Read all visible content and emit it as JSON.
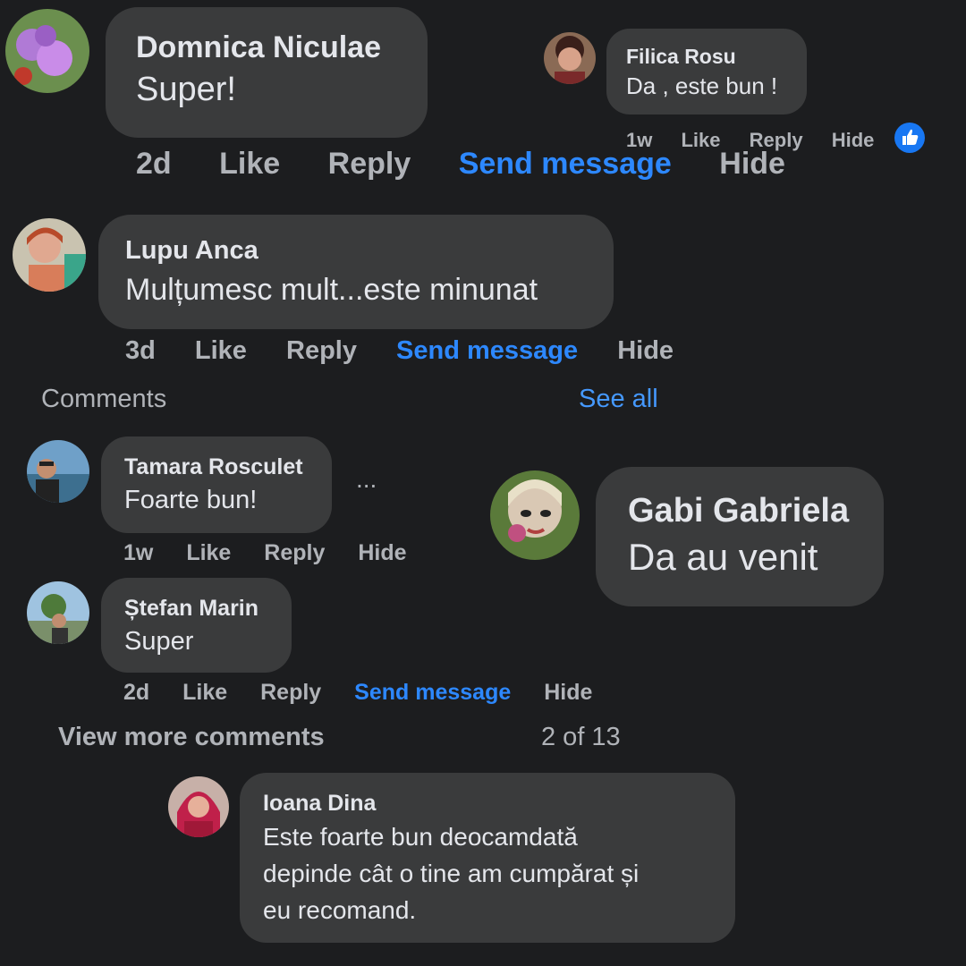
{
  "comments": {
    "domnica": {
      "name": "Domnica Niculae",
      "text": "Super!",
      "time": "2d",
      "like": "Like",
      "reply": "Reply",
      "send": "Send message",
      "hide": "Hide"
    },
    "filica": {
      "name": "Filica Rosu",
      "text": "Da , este bun !",
      "time": "1w",
      "like": "Like",
      "reply": "Reply",
      "hide": "Hide",
      "reaction_icon": "thumbs-up-icon"
    },
    "lupu": {
      "name": "Lupu Anca",
      "text": "Mulțumesc mult...este minunat",
      "time": "3d",
      "like": "Like",
      "reply": "Reply",
      "send": "Send message",
      "hide": "Hide"
    },
    "tamara": {
      "name": "Tamara Rosculet",
      "text": "Foarte bun!",
      "time": "1w",
      "like": "Like",
      "reply": "Reply",
      "hide": "Hide",
      "more": "..."
    },
    "gabi": {
      "name": "Gabi Gabriela",
      "text": "Da au venit"
    },
    "stefan": {
      "name": "Ștefan Marin",
      "text": "Super",
      "time": "2d",
      "like": "Like",
      "reply": "Reply",
      "send": "Send message",
      "hide": "Hide"
    },
    "ioana": {
      "name": "Ioana Dina",
      "lines": [
        "Este foarte bun deocamdată",
        "depinde cât o tine am cumpărat și",
        "eu recomand."
      ]
    }
  },
  "section": {
    "title": "Comments",
    "see_all": "See all"
  },
  "pagination": {
    "view_more": "View more comments",
    "count": "2 of 13"
  },
  "colors": {
    "background": "#1c1d1f",
    "bubble": "#3a3b3c",
    "link": "#2d88ff",
    "meta": "#b0b3b8"
  }
}
